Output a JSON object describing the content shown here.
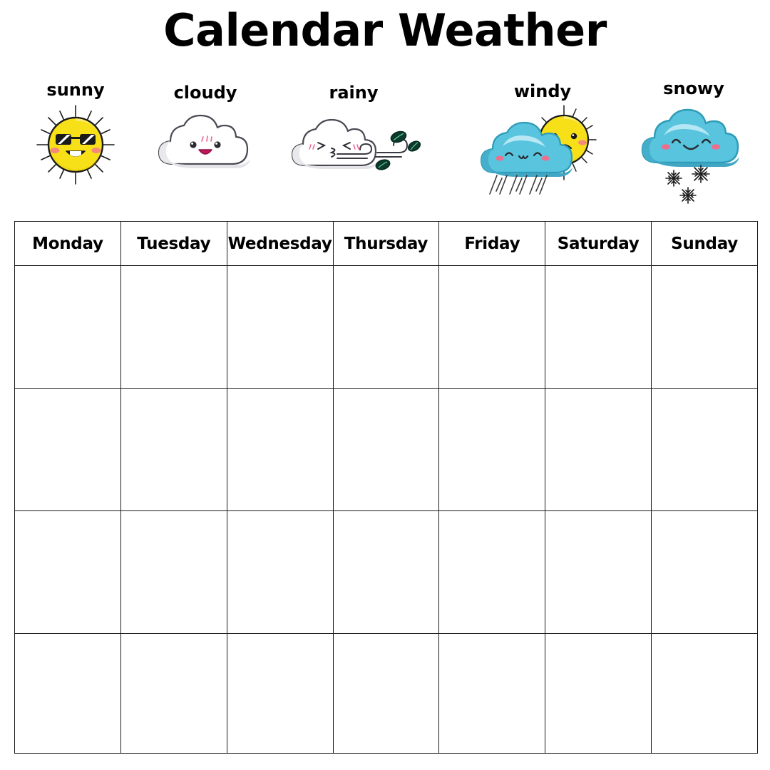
{
  "page": {
    "title": "Calendar Weather",
    "background_color": "#ffffff",
    "text_color": "#000000"
  },
  "legend": {
    "items": [
      {
        "label": "sunny",
        "icon": "sun-with-sunglasses-icon",
        "colors": {
          "body": "#F7E018",
          "shade": "#EFD200",
          "cheek": "#F58A7B",
          "ray": "#1a1a1a"
        }
      },
      {
        "label": "cloudy",
        "icon": "happy-white-cloud-icon",
        "colors": {
          "body": "#FFFFFF",
          "shade": "#E9E9EC",
          "outline": "#4A4A55",
          "mouth": "#C2185B"
        }
      },
      {
        "label": "rainy",
        "icon": "wind-blowing-cloud-with-leaves-icon",
        "colors": {
          "body": "#FFFFFF",
          "shade": "#E9E9EC",
          "outline": "#4A4A55",
          "leaf": "#0B3B2E"
        }
      },
      {
        "label": "windy",
        "icon": "rain-cloud-with-sad-sun-icon",
        "colors": {
          "cloud": "#58C4DD",
          "cloud_shade": "#45AECB",
          "sun": "#F7E018",
          "cheek": "#F58A7B",
          "rain": "#3A3A3A"
        }
      },
      {
        "label": "snowy",
        "icon": "snow-cloud-with-snowflakes-icon",
        "colors": {
          "cloud": "#58C4DD",
          "cloud_shade": "#45AECB",
          "cheek": "#EE6E8E",
          "snowflake": "#1a1a1a"
        }
      }
    ]
  },
  "calendar": {
    "columns": [
      "Monday",
      "Tuesday",
      "Wednesday",
      "Thursday",
      "Friday",
      "Saturday",
      "Sunday"
    ],
    "row_count": 4,
    "cells": [
      [
        "",
        "",
        "",
        "",
        "",
        "",
        ""
      ],
      [
        "",
        "",
        "",
        "",
        "",
        "",
        ""
      ],
      [
        "",
        "",
        "",
        "",
        "",
        "",
        ""
      ],
      [
        "",
        "",
        "",
        "",
        "",
        "",
        ""
      ]
    ],
    "border_color": "#1a1a1a"
  }
}
